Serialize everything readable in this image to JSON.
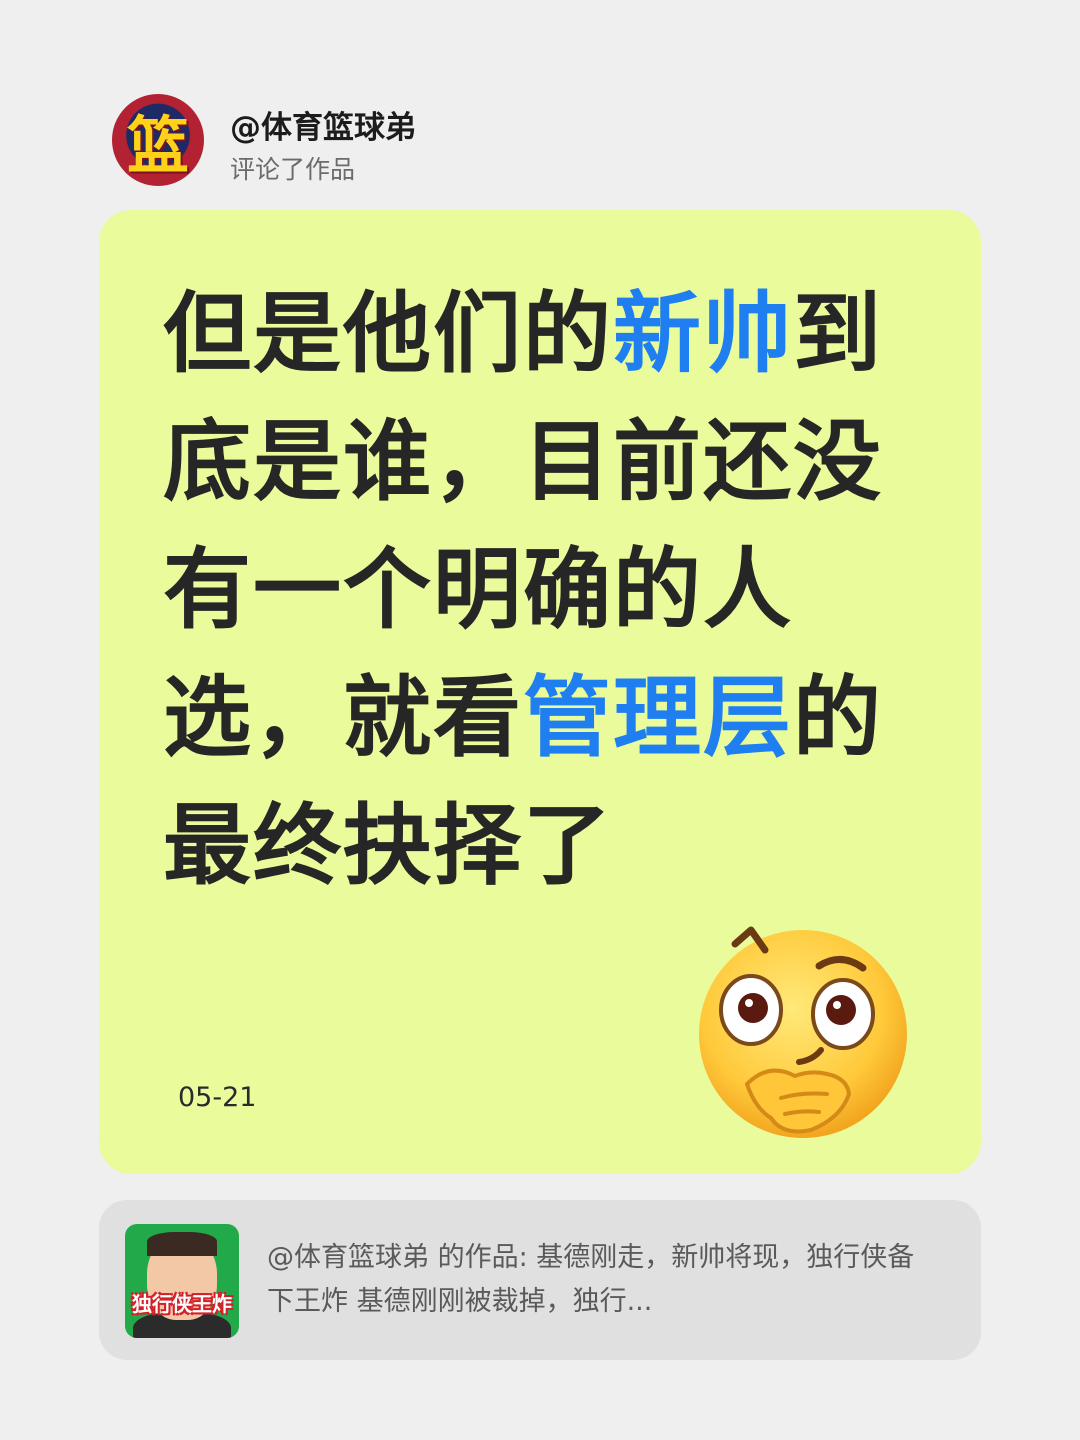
{
  "header": {
    "avatar_glyph": "篮",
    "username": "@体育篮球弟",
    "action": "评论了作品"
  },
  "comment": {
    "segments": [
      {
        "text": "但是他们的",
        "highlight": false
      },
      {
        "text": "新帅",
        "highlight": true
      },
      {
        "text": "到底是谁，目前还没有一个明确的人选，就看",
        "highlight": false
      },
      {
        "text": "管理层",
        "highlight": true
      },
      {
        "text": "的最终抉择了",
        "highlight": false
      }
    ],
    "date": "05-21",
    "emoji_icon": "thinking-face-icon"
  },
  "reference": {
    "thumb_label": "独行侠王炸",
    "text": "@体育篮球弟 的作品: 基德刚走，新帅将现，独行侠备下王炸 基德刚刚被裁掉，独行..."
  },
  "colors": {
    "background": "#efefef",
    "card": "#e9fb9a",
    "highlight": "#1f7ff0",
    "text": "#262626",
    "reference_bg": "#e0e0e0"
  }
}
